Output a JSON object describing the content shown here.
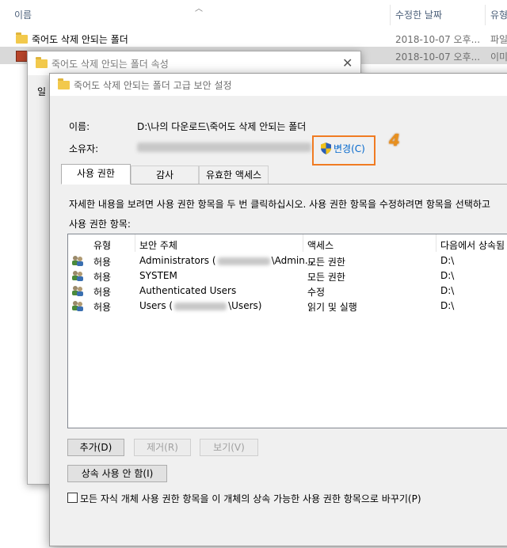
{
  "explorer": {
    "columns": {
      "name": "이름",
      "modified": "수정한 날짜",
      "type": "유형"
    },
    "rows": [
      {
        "name": "죽어도 삭제 안되는 폴더",
        "date": "2018-10-07 오후...",
        "type": "파일"
      },
      {
        "name": "죽어도 삭제 안되는 폴더",
        "date": "2018-10-07 오후...",
        "type": "이미"
      }
    ]
  },
  "properties_window": {
    "title": "죽어도 삭제 안되는 폴더 속성",
    "tab_partial": "일"
  },
  "advanced": {
    "title": "죽어도 삭제 안되는 폴더 고급 보안 설정",
    "name_label": "이름:",
    "name_value": "D:\\나의 다운로드\\죽어도 삭제 안되는 폴더",
    "owner_label": "소유자:",
    "change_link": "변경(C)",
    "step_number": "4",
    "tabs": [
      "사용 권한",
      "감사",
      "유효한 액세스"
    ],
    "instruction": "자세한 내용을 보려면 사용 권한 항목을 두 번 클릭하십시오. 사용 권한 항목을 수정하려면 항목을 선택하고",
    "entries_label": "사용 권한 항목:",
    "list_headers": [
      "유형",
      "보안 주체",
      "액세스",
      "다음에서 상속됨"
    ],
    "entries": [
      {
        "type": "허용",
        "principal_a": "Administrators (",
        "principal_b": "\\Admin...",
        "access": "모든 권한",
        "inherited": "D:\\"
      },
      {
        "type": "허용",
        "principal_a": "SYSTEM",
        "principal_b": "",
        "access": "모든 권한",
        "inherited": "D:\\"
      },
      {
        "type": "허용",
        "principal_a": "Authenticated Users",
        "principal_b": "",
        "access": "수정",
        "inherited": "D:\\"
      },
      {
        "type": "허용",
        "principal_a": "Users (",
        "principal_b": "\\Users)",
        "access": "읽기 및 실행",
        "inherited": "D:\\"
      }
    ],
    "buttons": {
      "add": "추가(D)",
      "remove": "제거(R)",
      "view": "보기(V)",
      "disable_inheritance": "상속 사용 안 함(I)"
    },
    "replace_checkbox": "모든 자식 개체 사용 권한 항목을 이 개체의 상속 가능한 사용 권한 항목으로 바꾸기(P)"
  },
  "colors": {
    "accent_link": "#0066cc",
    "highlight_box": "#f07b22",
    "step_number": "#e8901e"
  }
}
